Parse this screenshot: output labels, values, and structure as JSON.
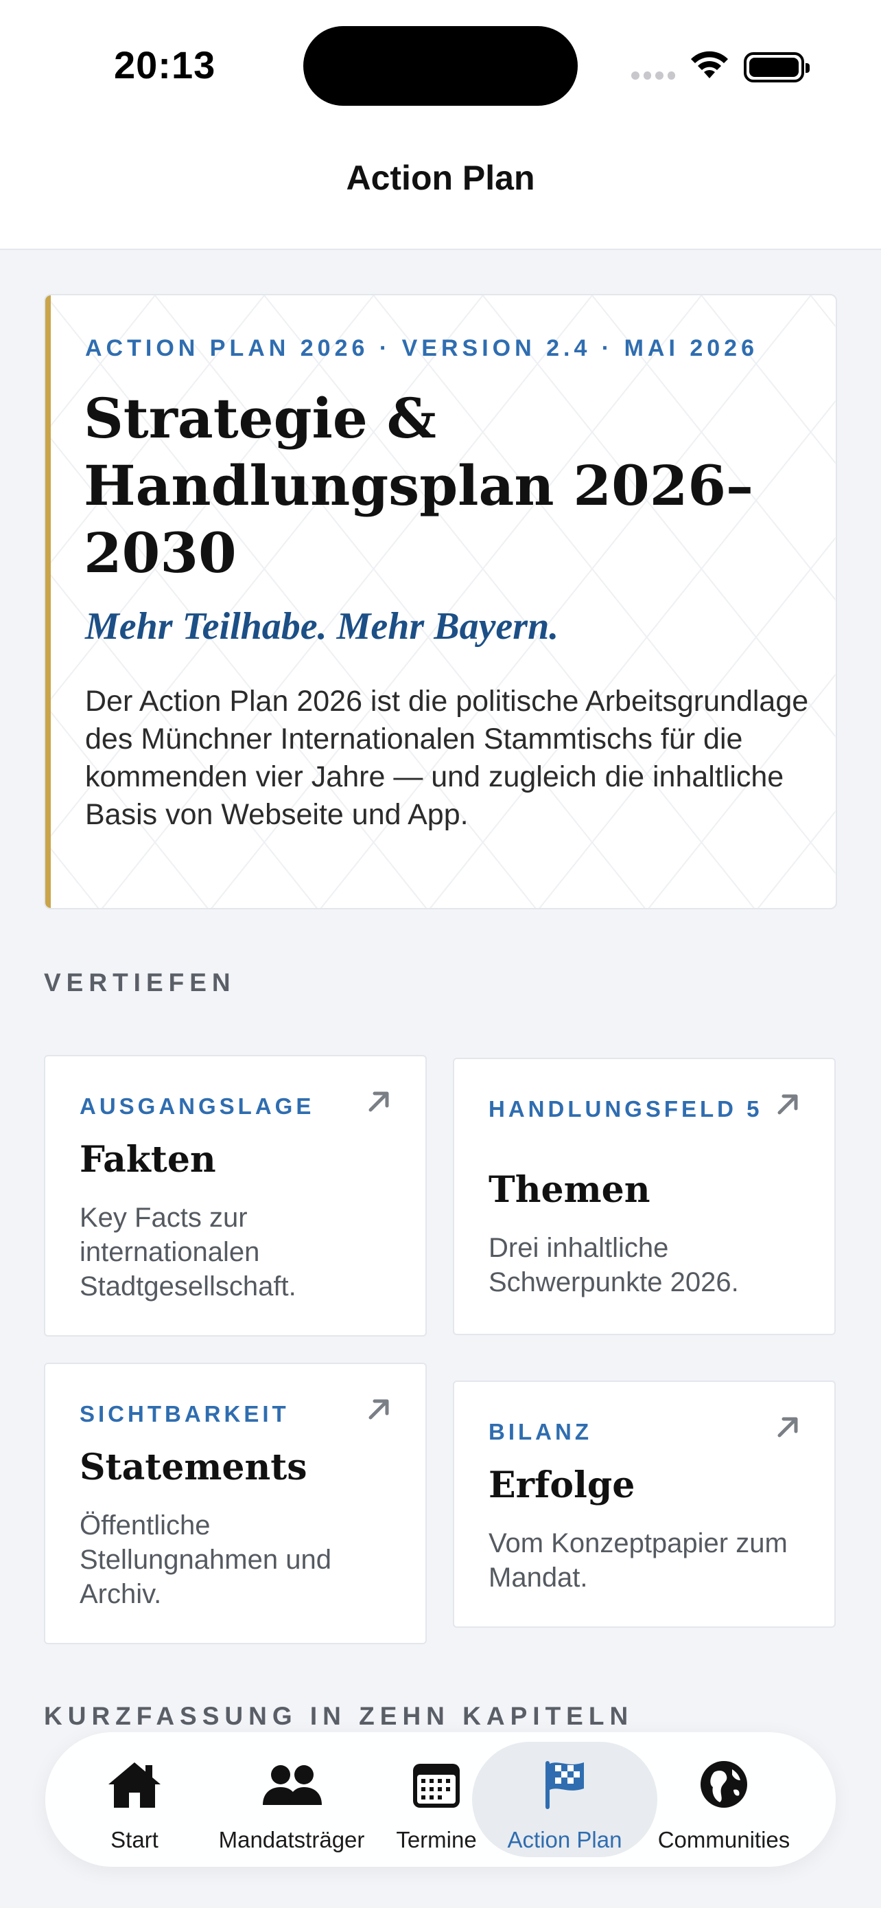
{
  "status_bar": {
    "time": "20:13"
  },
  "nav": {
    "title": "Action Plan"
  },
  "hero": {
    "eyebrow": "ACTION PLAN 2026 · VERSION 2.4 · MAI 2026",
    "title": "Strategie & Handlungsplan 2026–2030",
    "subtitle": "Mehr Teilhabe. Mehr Bayern.",
    "body": "Der Action Plan 2026 ist die politische Arbeitsgrundlage des Münchner Internationalen Stammtischs für die kommenden vier Jahre — und zugleich die inhaltliche Basis von Webseite und App.",
    "accent_color": "#c9a44a"
  },
  "sections": {
    "vertiefen": "VERTIEFEN",
    "kurzfassung": "KURZFASSUNG IN ZEHN KAPITELN"
  },
  "tiles": [
    {
      "eyebrow": "AUSGANGSLAGE",
      "title": "Fakten",
      "description": "Key Facts zur internationalen Stadtgesellschaft.",
      "icon": "arrow-up-right-icon"
    },
    {
      "eyebrow": "HANDLUNGSFELD 5",
      "title": "Themen",
      "description": "Drei inhaltliche Schwerpunkte 2026.",
      "icon": "arrow-up-right-icon"
    },
    {
      "eyebrow": "SICHTBARKEIT",
      "title": "Statements",
      "description": "Öffentliche Stellungnahmen und Archiv.",
      "icon": "arrow-up-right-icon"
    },
    {
      "eyebrow": "BILANZ",
      "title": "Erfolge",
      "description": "Vom Konzeptpapier zum Mandat.",
      "icon": "arrow-up-right-icon"
    }
  ],
  "tabbar": {
    "active": "Action Plan",
    "active_color": "#2f6db0",
    "items": [
      {
        "label": "Start",
        "icon": "house-icon"
      },
      {
        "label": "Mandatsträger",
        "icon": "people-icon"
      },
      {
        "label": "Termine",
        "icon": "calendar-icon"
      },
      {
        "label": "Action Plan",
        "icon": "checkered-flag-icon"
      },
      {
        "label": "Communities",
        "icon": "globe-icon"
      }
    ]
  }
}
